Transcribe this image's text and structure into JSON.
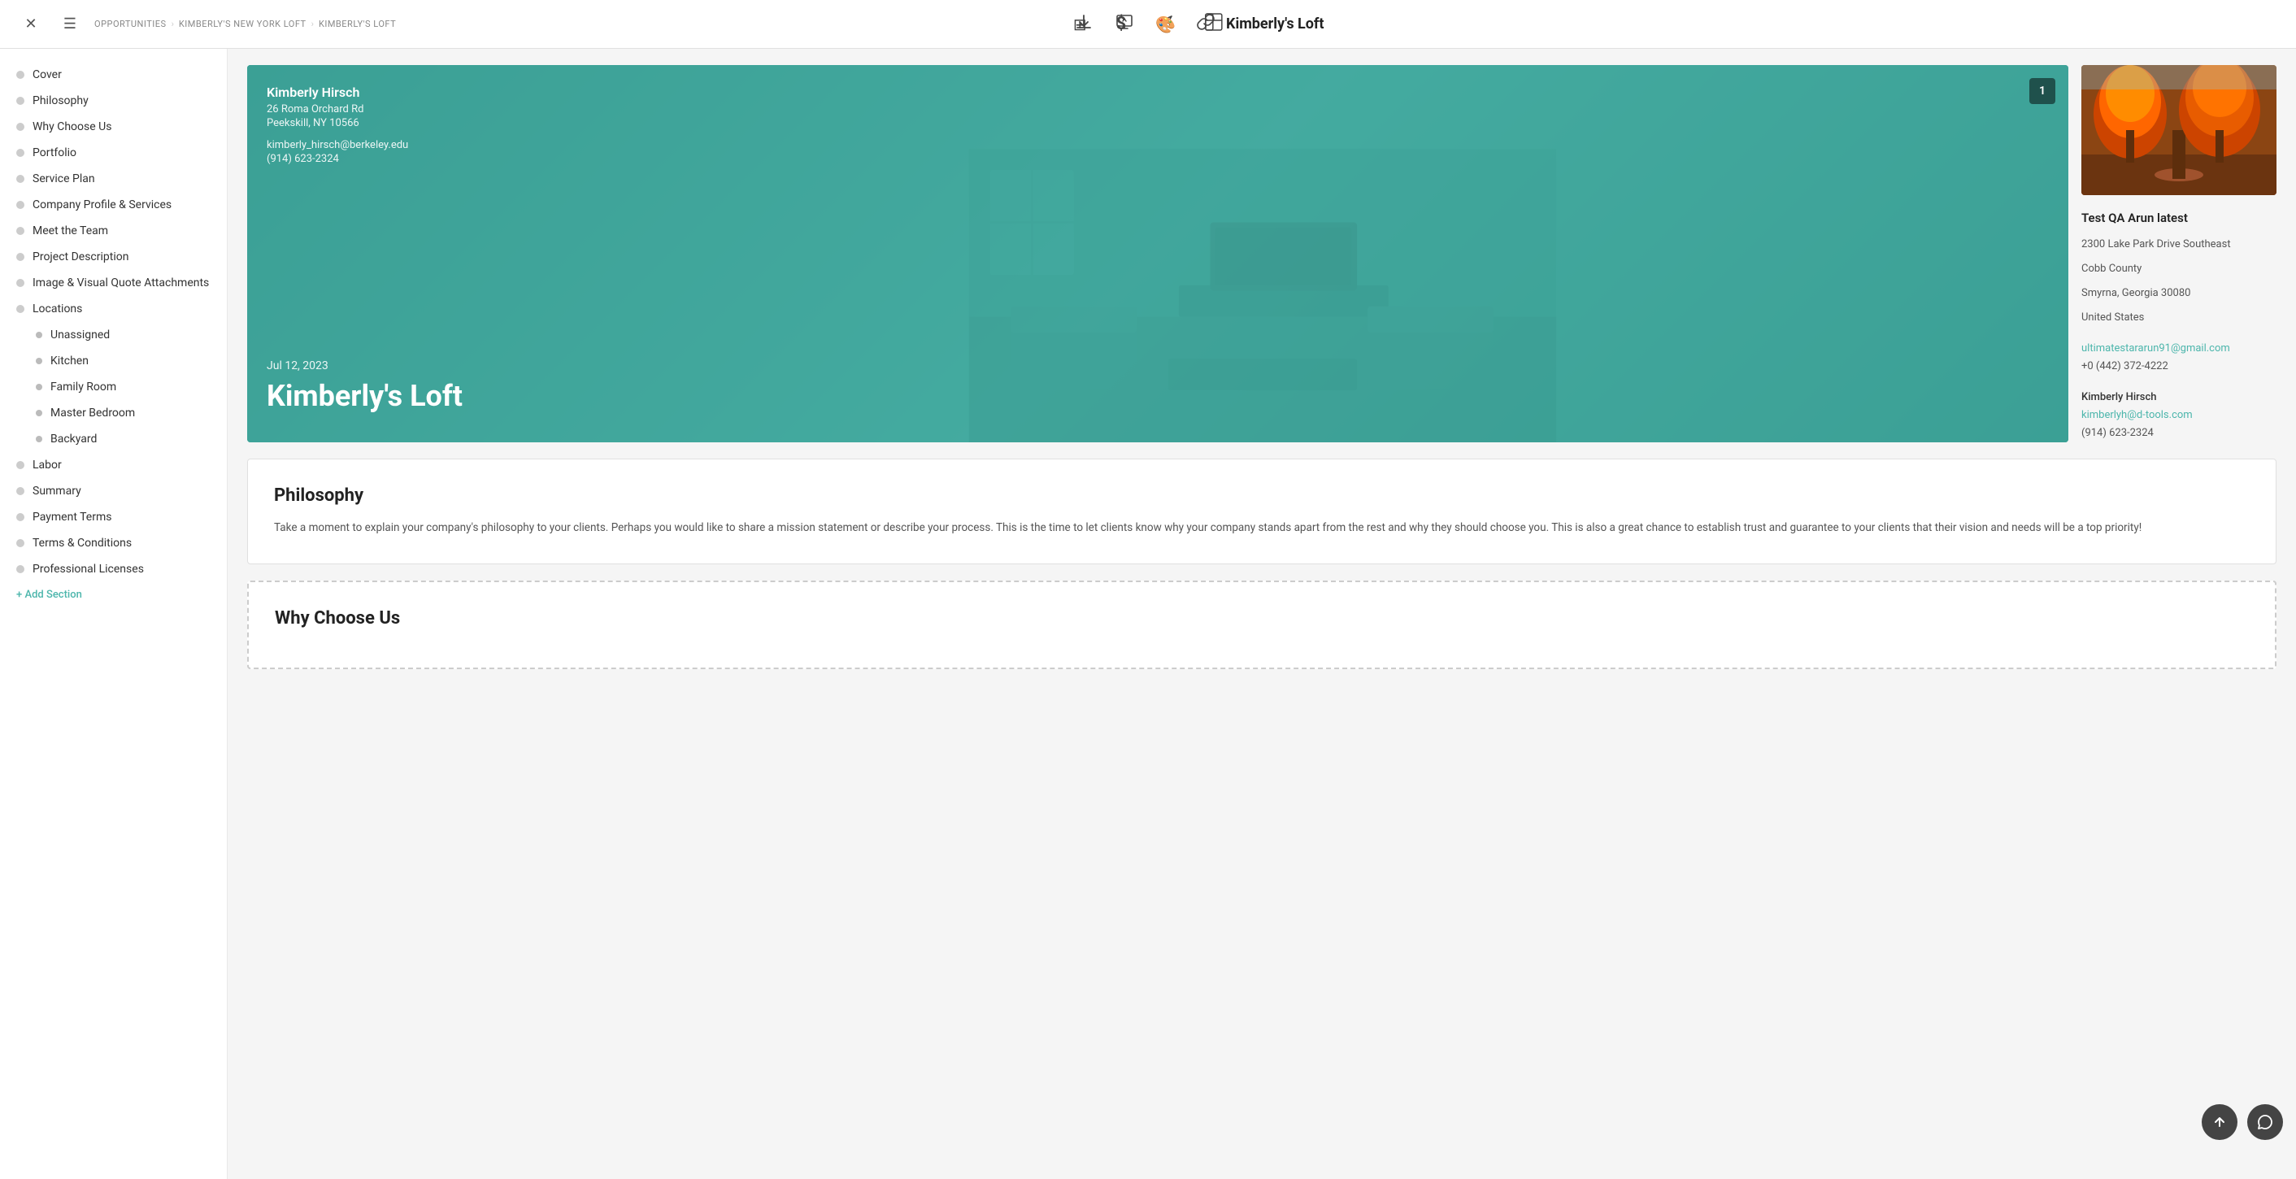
{
  "topbar": {
    "close_label": "✕",
    "menu_label": "☰",
    "breadcrumb": [
      "OPPORTUNITIES",
      "KIMBERLY'S NEW YORK LOFT",
      "KIMBERLY'S LOFT"
    ],
    "title": "Kimberly's Loft",
    "icons": {
      "grid": "⊞",
      "dollar": "$",
      "palette": "🎨",
      "layout": "⊟",
      "download": "⬇",
      "present": "⬆",
      "send": "✈",
      "link": "🔗"
    }
  },
  "sidebar": {
    "items": [
      {
        "label": "Cover",
        "sub": false
      },
      {
        "label": "Philosophy",
        "sub": false
      },
      {
        "label": "Why Choose Us",
        "sub": false
      },
      {
        "label": "Portfolio",
        "sub": false
      },
      {
        "label": "Service Plan",
        "sub": false
      },
      {
        "label": "Company Profile & Services",
        "sub": false
      },
      {
        "label": "Meet the Team",
        "sub": false
      },
      {
        "label": "Project Description",
        "sub": false
      },
      {
        "label": "Image & Visual Quote Attachments",
        "sub": false
      },
      {
        "label": "Locations",
        "sub": false
      },
      {
        "label": "Unassigned",
        "sub": true
      },
      {
        "label": "Kitchen",
        "sub": true
      },
      {
        "label": "Family Room",
        "sub": true
      },
      {
        "label": "Master Bedroom",
        "sub": true
      },
      {
        "label": "Backyard",
        "sub": true
      },
      {
        "label": "Labor",
        "sub": false
      },
      {
        "label": "Summary",
        "sub": false
      },
      {
        "label": "Payment Terms",
        "sub": false
      },
      {
        "label": "Terms & Conditions",
        "sub": false
      },
      {
        "label": "Professional Licenses",
        "sub": false
      }
    ],
    "add_section": "+ Add Section"
  },
  "cover": {
    "badge": "1",
    "client_name": "Kimberly Hirsch",
    "address_line1": "26 Roma Orchard Rd",
    "address_line2": "Peekskill, NY 10566",
    "email": "kimberly_hirsch@berkeley.edu",
    "phone": "(914) 623-2324",
    "date": "Jul 12, 2023",
    "project_name": "Kimberly's Loft",
    "side": {
      "company_name": "Test QA Arun latest",
      "address_line1": "2300 Lake Park Drive Southeast",
      "address_line2": "Cobb County",
      "address_line3": "Smyrna, Georgia 30080",
      "address_line4": "United States",
      "company_email": "ultimatestararun91@gmail.com",
      "company_phone": "+0 (442) 372-4222",
      "contact_name": "Kimberly Hirsch",
      "contact_email": "kimberlyh@d-tools.com",
      "contact_phone": "(914) 623-2324"
    }
  },
  "philosophy": {
    "title": "Philosophy",
    "body": "Take a moment to explain your company's philosophy to your clients. Perhaps you would like to share a mission statement or describe your process. This is the time to let clients know why your company stands apart from the rest and why they should choose you. This is also a great chance to establish trust and guarantee to your clients that their vision and needs will be a top priority!"
  },
  "why_choose_us": {
    "title": "Why Choose Us"
  }
}
